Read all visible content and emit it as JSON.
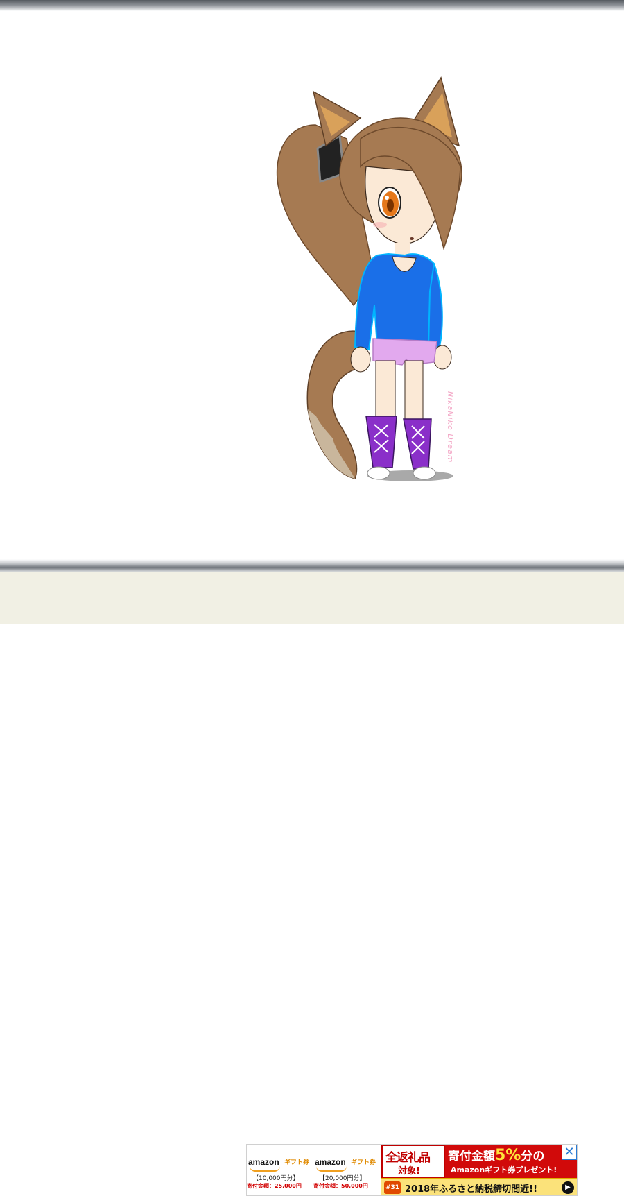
{
  "artwork": {
    "description": "",
    "signature": "NikaNiko Dream",
    "colors": {
      "hair": "#a67a52",
      "hair_shade": "#7e5534",
      "ear_inner": "#d9a15a",
      "skin": "#fbe9d6",
      "eye": "#e5781b",
      "shirt": "#1a6fe8",
      "shirt_outline": "#00b4ff",
      "shorts": "#e2a9ee",
      "boots": "#8a2fc9",
      "shadow": "#9a9a9a"
    }
  },
  "ad": {
    "cards": [
      {
        "brand": "amazon",
        "gift": "ギフト券",
        "amount": "【10,000円分】",
        "donation": "寄付金額：25,000円"
      },
      {
        "brand": "amazon",
        "gift": "ギフト券",
        "amount": "【20,000円分】",
        "donation": "寄付金額：50,000円"
      }
    ],
    "promo_box": {
      "line1": "全返礼品",
      "line2": "対象!"
    },
    "promo_red": {
      "prefix": "寄付金額",
      "highlight": "5%",
      "suffix": "分の",
      "line2": "Amazonギフト券プレゼント!"
    },
    "bottom": {
      "badge": "#31",
      "deadline": "2018年ふるさと納税締切間近!!",
      "arrow_icon": "play-arrow-icon"
    },
    "close_icon": "close-icon"
  }
}
